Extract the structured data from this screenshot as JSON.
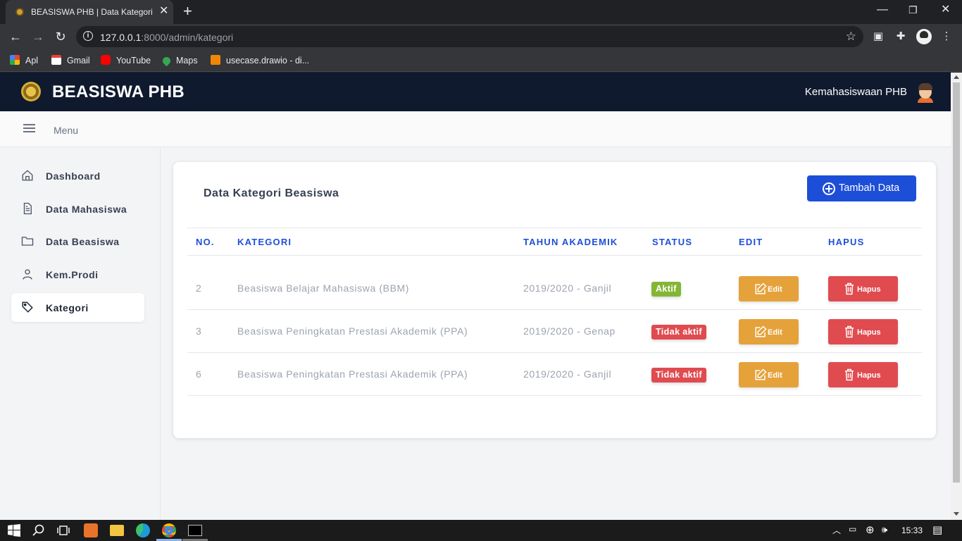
{
  "browser": {
    "tab_title": "BEASISWA PHB | Data Kategori",
    "url_host": "127.0.0.1",
    "url_path": ":8000/admin/kategori",
    "bookmarks": [
      "Apl",
      "Gmail",
      "YouTube",
      "Maps",
      "usecase.drawio - di..."
    ]
  },
  "header": {
    "brand": "BEASISWA PHB",
    "user": "Kemahasiswaan PHB"
  },
  "menubar": {
    "label": "Menu"
  },
  "sidebar": {
    "items": [
      {
        "label": "Dashboard",
        "icon": "home-icon"
      },
      {
        "label": "Data Mahasiswa",
        "icon": "document-icon"
      },
      {
        "label": "Data Beasiswa",
        "icon": "folder-icon"
      },
      {
        "label": "Kem.Prodi",
        "icon": "user-icon"
      },
      {
        "label": "Kategori",
        "icon": "tag-icon",
        "active": true
      }
    ]
  },
  "main": {
    "title": "Data Kategori Beasiswa",
    "add_button": "Tambah Data",
    "columns": [
      "NO.",
      "KATEGORI",
      "TAHUN AKADEMIK",
      "STATUS",
      "EDIT",
      "HAPUS"
    ],
    "rows": [
      {
        "no": "2",
        "kategori": "Beasiswa Belajar Mahasiswa (BBM)",
        "tahun": "2019/2020 - Ganjil",
        "status": "Aktif",
        "active": true,
        "edit": "Edit",
        "hapus": "Hapus"
      },
      {
        "no": "3",
        "kategori": "Beasiswa Peningkatan Prestasi Akademik (PPA)",
        "tahun": "2019/2020 - Genap",
        "status": "Tidak aktif",
        "active": false,
        "edit": "Edit",
        "hapus": "Hapus"
      },
      {
        "no": "6",
        "kategori": "Beasiswa Peningkatan Prestasi Akademik (PPA)",
        "tahun": "2019/2020 - Ganjil",
        "status": "Tidak aktif",
        "active": false,
        "edit": "Edit",
        "hapus": "Hapus"
      }
    ]
  },
  "colors": {
    "header_bg": "#0f1a2e",
    "primary": "#1d4ed8",
    "active_badge": "#84b635",
    "inactive_badge": "#e04b50",
    "edit_button": "#e5a23b",
    "delete_button": "#e04b50"
  },
  "taskbar": {
    "time": "15:33"
  }
}
